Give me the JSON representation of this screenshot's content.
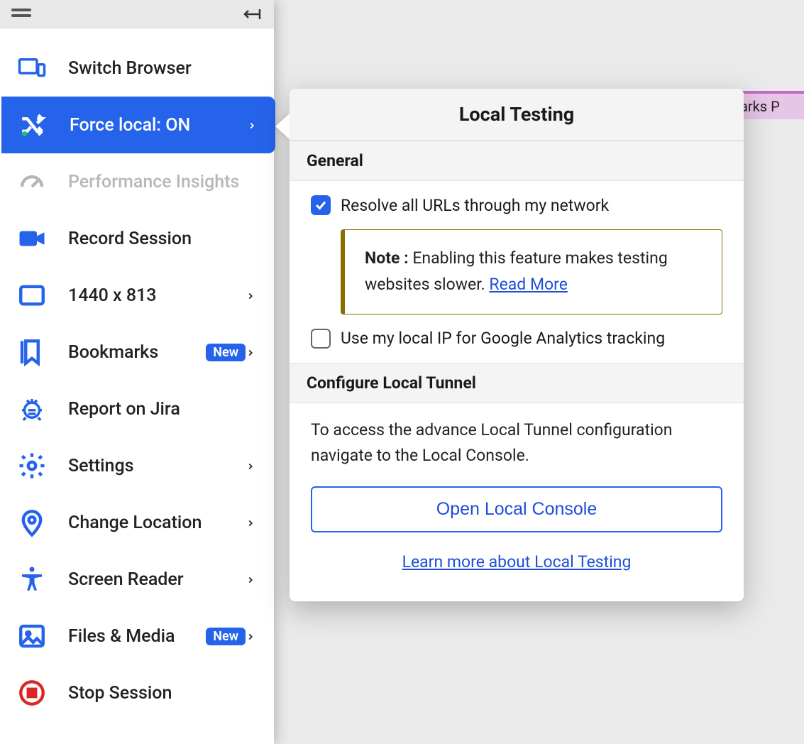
{
  "sidebar": {
    "items": [
      {
        "label": "Switch Browser",
        "icon": "devices",
        "chevron": false,
        "badge": null,
        "active": false,
        "disabled": false
      },
      {
        "label": "Force local: ON",
        "icon": "shuffle",
        "chevron": true,
        "badge": null,
        "active": true,
        "disabled": false
      },
      {
        "label": "Performance Insights",
        "icon": "gauge",
        "chevron": false,
        "badge": null,
        "active": false,
        "disabled": true
      },
      {
        "label": "Record Session",
        "icon": "video",
        "chevron": false,
        "badge": null,
        "active": false,
        "disabled": false
      },
      {
        "label": "1440 x 813",
        "icon": "aspect",
        "chevron": true,
        "badge": null,
        "active": false,
        "disabled": false
      },
      {
        "label": "Bookmarks",
        "icon": "bookmark",
        "chevron": true,
        "badge": "New",
        "active": false,
        "disabled": false
      },
      {
        "label": "Report on Jira",
        "icon": "bug",
        "chevron": false,
        "badge": null,
        "active": false,
        "disabled": false
      },
      {
        "label": "Settings",
        "icon": "gear",
        "chevron": true,
        "badge": null,
        "active": false,
        "disabled": false
      },
      {
        "label": "Change Location",
        "icon": "pin",
        "chevron": true,
        "badge": null,
        "active": false,
        "disabled": false
      },
      {
        "label": "Screen Reader",
        "icon": "accessibility",
        "chevron": true,
        "badge": null,
        "active": false,
        "disabled": false
      },
      {
        "label": "Files & Media",
        "icon": "image",
        "chevron": true,
        "badge": "New",
        "active": false,
        "disabled": false
      },
      {
        "label": "Stop Session",
        "icon": "stop",
        "chevron": false,
        "badge": null,
        "active": false,
        "disabled": false
      }
    ]
  },
  "flyout": {
    "title": "Local Testing",
    "general": {
      "heading": "General",
      "resolve": {
        "label": "Resolve all URLs through my network",
        "checked": true
      },
      "note_prefix": "Note :",
      "note_text": " Enabling this feature makes testing websites slower. ",
      "note_link": "Read More",
      "ga": {
        "label": "Use my local IP for Google Analytics tracking",
        "checked": false
      }
    },
    "tunnel": {
      "heading": "Configure Local Tunnel",
      "desc": "To access the advance Local Tunnel configuration navigate to the Local Console.",
      "button": "Open Local Console",
      "learn": "Learn more about Local Testing"
    }
  },
  "bg": {
    "tab_text": "arks    P"
  }
}
